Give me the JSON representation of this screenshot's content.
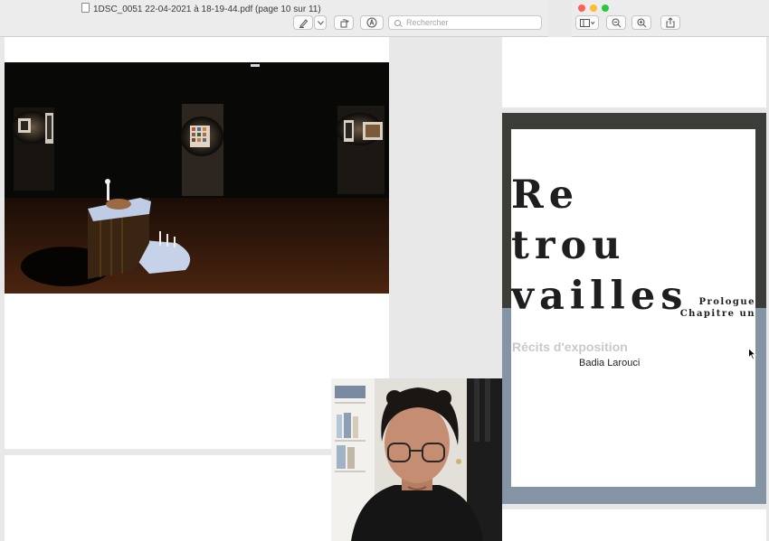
{
  "left_window": {
    "title": "1DSC_0051 22-04-2021 à 18-19-44.pdf (page 10 sur 11)",
    "search": {
      "placeholder": "Rechercher"
    },
    "toolbar": [
      "pen-markup-icon",
      "chevron-down-icon",
      "rotate-icon",
      "annotate-icon"
    ]
  },
  "right_window": {
    "traffic_lights": {
      "close": "#fe5f57",
      "minimize": "#febc2e",
      "zoom": "#28c840"
    },
    "toolbar": [
      "sidebar-toggle-icon",
      "zoom-out-icon",
      "zoom-in-icon",
      "share-icon"
    ]
  },
  "cover": {
    "title_lines": [
      "Re",
      "trou",
      "vailles"
    ],
    "prologue": "Prologue",
    "chapter": "Chapitre un",
    "subtitle": "Récits d'exposition",
    "author": "Badia Larouci",
    "colors": {
      "frame_top": "#3a3d38",
      "frame_bottom": "#8494a4"
    }
  }
}
